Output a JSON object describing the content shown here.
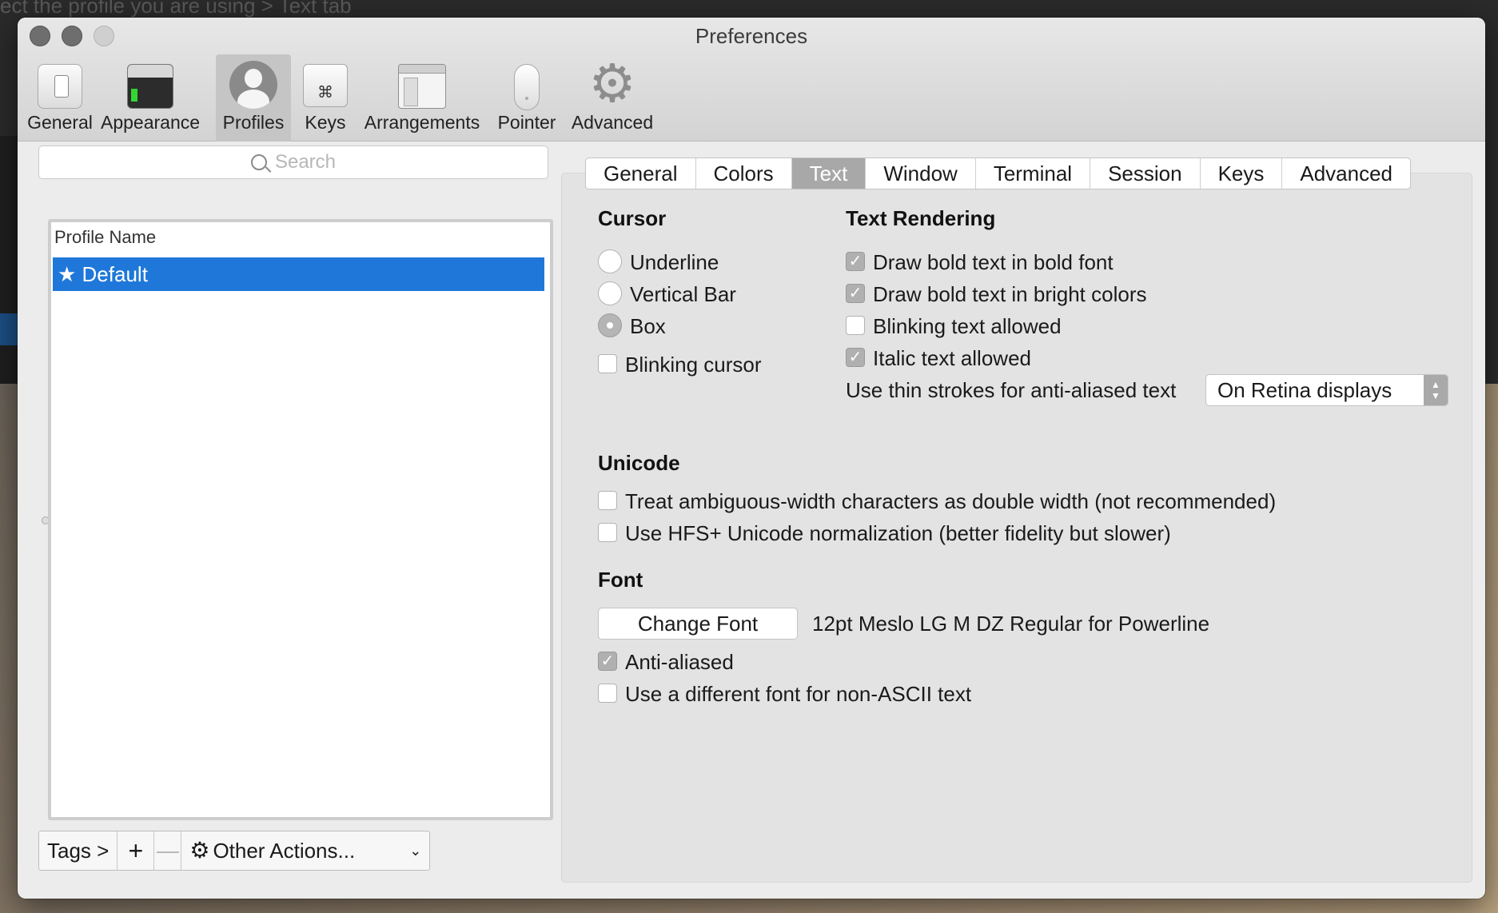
{
  "background": {
    "snippet": "ect the profile you are using > Text tab"
  },
  "window": {
    "title": "Preferences"
  },
  "toolbar": {
    "items": [
      {
        "label": "General",
        "icon": "general-icon"
      },
      {
        "label": "Appearance",
        "icon": "appearance-icon"
      },
      {
        "label": "Profiles",
        "icon": "profile-icon",
        "selected": true
      },
      {
        "label": "Keys",
        "icon": "keys-icon"
      },
      {
        "label": "Arrangements",
        "icon": "arrangements-icon"
      },
      {
        "label": "Pointer",
        "icon": "pointer-icon"
      },
      {
        "label": "Advanced",
        "icon": "gear-icon"
      }
    ]
  },
  "profiles": {
    "search_placeholder": "Search",
    "column_header": "Profile Name",
    "rows": [
      {
        "label": "★ Default",
        "selected": true
      }
    ],
    "actions": {
      "tags": "Tags >",
      "add": "+",
      "remove": "—",
      "other": "Other Actions...",
      "chevron": "⌄"
    }
  },
  "tabs": {
    "items": [
      "General",
      "Colors",
      "Text",
      "Window",
      "Terminal",
      "Session",
      "Keys",
      "Advanced"
    ],
    "active": "Text"
  },
  "cursor": {
    "heading": "Cursor",
    "options": [
      {
        "label": "Underline",
        "selected": false
      },
      {
        "label": "Vertical Bar",
        "selected": false
      },
      {
        "label": "Box",
        "selected": true
      }
    ],
    "blinking": {
      "label": "Blinking cursor",
      "checked": false
    }
  },
  "text_rendering": {
    "heading": "Text Rendering",
    "options": [
      {
        "label": "Draw bold text in bold font",
        "checked": true
      },
      {
        "label": "Draw bold text in bright colors",
        "checked": true
      },
      {
        "label": "Blinking text allowed",
        "checked": false
      },
      {
        "label": "Italic text allowed",
        "checked": true
      }
    ],
    "thin_strokes_label": "Use thin strokes for anti-aliased text",
    "thin_strokes_value": "On Retina displays"
  },
  "unicode": {
    "heading": "Unicode",
    "options": [
      {
        "label": "Treat ambiguous-width characters as double width (not recommended)",
        "checked": false
      },
      {
        "label": "Use HFS+ Unicode normalization (better fidelity but slower)",
        "checked": false
      }
    ]
  },
  "font": {
    "heading": "Font",
    "change_button": "Change Font",
    "current": "12pt Meslo LG M DZ Regular for Powerline",
    "options": [
      {
        "label": "Anti-aliased",
        "checked": true
      },
      {
        "label": "Use a different font for non-ASCII text",
        "checked": false
      }
    ]
  },
  "colors": {
    "selection": "#1f78d9",
    "active_tab": "#a8a8a8"
  }
}
